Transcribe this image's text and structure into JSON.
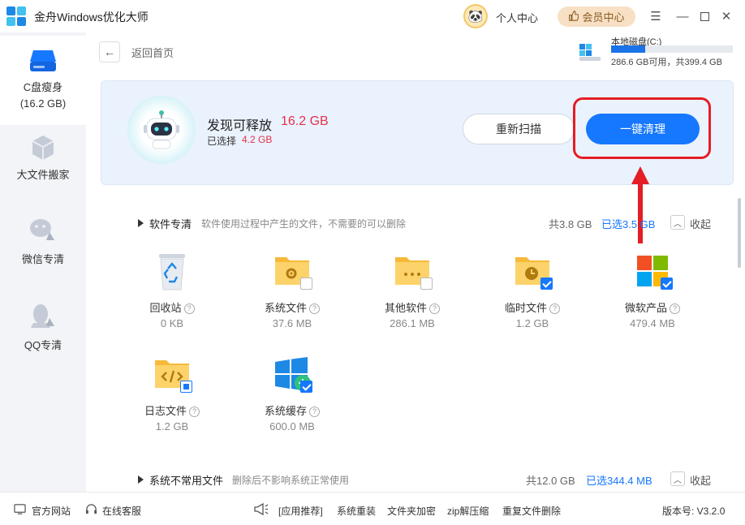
{
  "app": {
    "title": "金舟Windows优化大师"
  },
  "header": {
    "user_center": "个人中心",
    "vip_label": "会员中心"
  },
  "sidebar": {
    "items": [
      {
        "label": "C盘瘦身",
        "sub": "(16.2 GB)"
      },
      {
        "label": "大文件搬家"
      },
      {
        "label": "微信专清"
      },
      {
        "label": "QQ专清"
      }
    ]
  },
  "nav": {
    "back_label": "返回首页"
  },
  "disk": {
    "name": "本地磁盘(C:)",
    "info": "286.6 GB可用，共399.4 GB",
    "used_fraction": 0.28
  },
  "scan": {
    "found_label": "发现可释放",
    "found_size": "16.2 GB",
    "selected_label": "已选择",
    "selected_size": "4.2 GB",
    "rescan_label": "重新扫描",
    "clean_label": "一键清理"
  },
  "sections": [
    {
      "title": "软件专清",
      "desc": "软件使用过程中产生的文件，不需要的可以删除",
      "total": "共3.8 GB",
      "selected": "已选3.5 GB",
      "collapse": "收起",
      "items": [
        {
          "name": "回收站",
          "size": "0 KB"
        },
        {
          "name": "系统文件",
          "size": "37.6 MB"
        },
        {
          "name": "其他软件",
          "size": "286.1 MB"
        },
        {
          "name": "临时文件",
          "size": "1.2 GB"
        },
        {
          "name": "微软产品",
          "size": "479.4 MB"
        },
        {
          "name": "日志文件",
          "size": "1.2 GB"
        },
        {
          "name": "系统缓存",
          "size": "600.0 MB"
        }
      ]
    },
    {
      "title": "系统不常用文件",
      "desc": "删除后不影响系统正常使用",
      "total": "共12.0 GB",
      "selected": "已选344.4 MB",
      "collapse": "收起"
    }
  ],
  "footer": {
    "website": "官方网站",
    "support": "在线客服",
    "recommend": "[应用推荐]",
    "links": [
      "系统重装",
      "文件夹加密",
      "zip解压缩",
      "重复文件删除"
    ],
    "version": "版本号: V3.2.0"
  },
  "colors": {
    "accent": "#1677ff",
    "highlight": "#e51d24",
    "danger_text": "#e5324a"
  }
}
